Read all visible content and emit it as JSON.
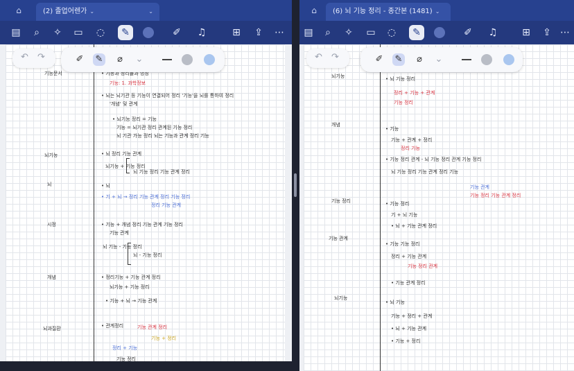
{
  "left_pane": {
    "tab_title": "(2) 졸업어렌가",
    "tab_chevron": "⌄",
    "toolbar_icons": [
      "sidebar-icon",
      "search-icon",
      "shape-recognition-icon",
      "document-icon",
      "lasso-icon",
      "pen-active-icon",
      "more-dot",
      "pencil-icon",
      "microphone-icon",
      "add-page-icon",
      "share-icon",
      "more-icon"
    ],
    "notes_left_margin": [
      "기능문서",
      "뇌기능",
      "뇌",
      "시정",
      "개념",
      "뇌과질환"
    ],
    "notes_main": [
      {
        "text": "• 기능과 정리들과 명칭",
        "color": "dark"
      },
      {
        "text": "기능: 1. 과학정보",
        "color": "red"
      },
      {
        "text": "• 뇌는 뇌기관 등 기능이 연결되어 정리 '기능'을 뇌를 통하여 정리",
        "color": "dark"
      },
      {
        "text": "'개념' 및 관계",
        "color": "dark"
      },
      {
        "text": "• 뇌기능 정리 = 기능",
        "color": "dark"
      },
      {
        "text": "기능 = 뇌기관 정리 관계된 기능 정리",
        "color": "dark"
      },
      {
        "text": "뇌 기관 가능 정리 뇌는 기능과 관계 정리 기능",
        "color": "dark"
      },
      {
        "text": "• 뇌 정리 기능 관계",
        "color": "dark"
      },
      {
        "text": "뇌기능 + 기능 정리",
        "color": "dark"
      },
      {
        "text": "뇌 기능 정리 기능 관계 정리",
        "color": "dark"
      },
      {
        "text": "• 뇌",
        "color": "dark"
      },
      {
        "text": "• 기 + 뇌 → 정리 기능 관계 정리 기능 정리",
        "color": "blue"
      },
      {
        "text": "정리 기능 관계",
        "color": "blue"
      },
      {
        "text": "• 기능 + 개념 정리 기능 관계 기능 정리",
        "color": "dark"
      },
      {
        "text": "기능 관계",
        "color": "dark"
      },
      {
        "text": "뇌 기능 - 기능 정리",
        "color": "dark"
      },
      {
        "text": "뇌 - 기능 정리",
        "color": "dark"
      },
      {
        "text": "• 정리기능 + 기능 관계 정리",
        "color": "dark"
      },
      {
        "text": "뇌기능 + 기능 정리",
        "color": "dark"
      },
      {
        "text": "• 기능 + 뇌 → 기능 관계",
        "color": "dark"
      },
      {
        "text": "• 관계정리",
        "color": "dark"
      },
      {
        "text": "기능 관계 정리",
        "color": "red"
      },
      {
        "text": "기능 + 정리",
        "color": "yellow"
      },
      {
        "text": "정리 + 기능",
        "color": "blue"
      },
      {
        "text": "기능 정리",
        "color": "dark"
      }
    ]
  },
  "right_pane": {
    "tab_title": "(6) 뇌 기능 정리 - 종간본 (1481)",
    "tab_chevron": "⌄",
    "toolbar_icons": [
      "sidebar-icon",
      "search-icon",
      "shape-recognition-icon",
      "document-icon",
      "lasso-icon",
      "pen-active-icon",
      "more-dot",
      "pencil-icon",
      "microphone-icon",
      "add-page-icon",
      "share-icon",
      "more-icon"
    ],
    "notes_left_margin": [
      "뇌기능",
      "개념",
      "기능 정리",
      "기능 관계",
      "뇌기능"
    ],
    "notes_main": [
      {
        "text": "• 뇌 기능 정리",
        "color": "dark"
      },
      {
        "text": "정리 + 기능 + 관계",
        "color": "red"
      },
      {
        "text": "기능 정리",
        "color": "red"
      },
      {
        "text": "• 기능",
        "color": "dark"
      },
      {
        "text": "기능 + 관계 + 정리",
        "color": "dark"
      },
      {
        "text": "정리 기능",
        "color": "red"
      },
      {
        "text": "• 기능 정리 관계 - 뇌 기능 정리 관계 기능 정리",
        "color": "dark"
      },
      {
        "text": "뇌 기능 정리 기능 관계 정리 기능",
        "color": "dark"
      },
      {
        "text": "기능 관계",
        "color": "blue"
      },
      {
        "text": "기능 정리 기능 관계 정리",
        "color": "red"
      },
      {
        "text": "• 기능 정리",
        "color": "dark"
      },
      {
        "text": "기 + 뇌 기능",
        "color": "dark"
      },
      {
        "text": "• 뇌 + 기능 관계 정리",
        "color": "dark"
      },
      {
        "text": "• 기능 기능 정리",
        "color": "dark"
      },
      {
        "text": "정리 + 기능 관계",
        "color": "dark"
      },
      {
        "text": "기능 정리 관계",
        "color": "red"
      },
      {
        "text": "• 기능 관계 정리",
        "color": "dark"
      },
      {
        "text": "• 뇌 기능",
        "color": "dark"
      },
      {
        "text": "기능 + 정리 + 관계",
        "color": "dark"
      },
      {
        "text": "• 뇌 + 기능 관계",
        "color": "dark"
      },
      {
        "text": "• 기능 + 정리",
        "color": "dark"
      }
    ]
  },
  "pen_tray": {
    "undo": "↶",
    "redo": "↷",
    "tools": [
      "pen-icon",
      "highlighter-icon",
      "eraser-icon",
      "tool-more-icon",
      "line-width-icon",
      "color-gray",
      "color-blue"
    ]
  }
}
